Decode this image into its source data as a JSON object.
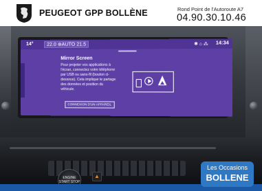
{
  "header": {
    "brand": "PEUGEOT GPP BOLLÈNE",
    "address": "Rond Point de l'Autoroute A7",
    "phone": "04.90.30.10.46",
    "logo_icon": "peugeot-lion-icon"
  },
  "screen": {
    "status": {
      "outside_temp": "14°",
      "climate": "22.0 ⊛AUTO 21.5",
      "icons": "✱ ⌂ ⁂",
      "time": "14:34"
    },
    "mirror": {
      "title": "Mirror Screen",
      "description": "Pour projeter vos applications à l'écran, connectez votre téléphone par USB ou sans-fil (bouton ci-dessous). Cela implique le partage des données et position du véhicule.",
      "connect_button": "CONNEXION D'UN APPAREIL",
      "icons": [
        "phone-icon",
        "play-icon",
        "navigation-icon"
      ]
    },
    "accent_color": "#5d3fa6"
  },
  "console": {
    "start_button": "ENGINE START STOP"
  },
  "badge": {
    "line1": "Les Occasions",
    "line2": "BOLLENE",
    "color": "#2f79c4"
  }
}
